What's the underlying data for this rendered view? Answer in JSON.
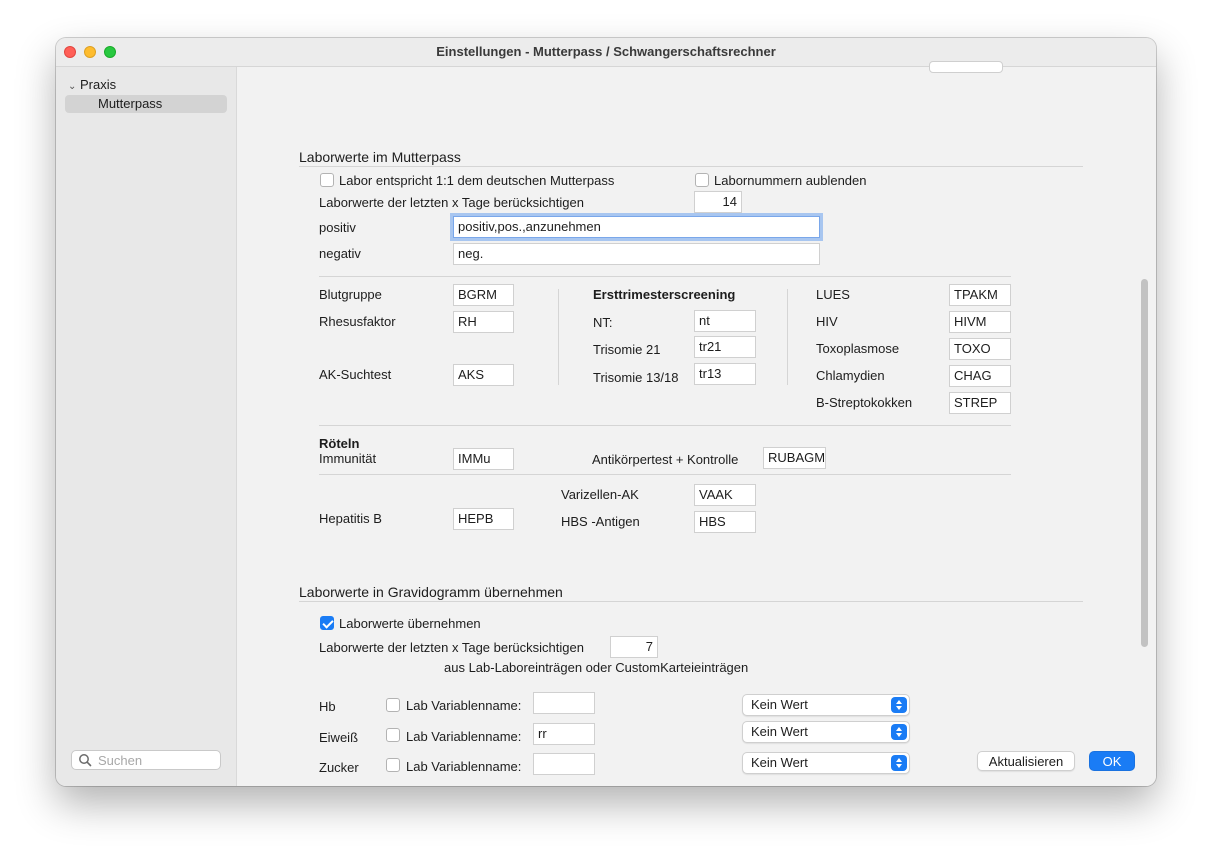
{
  "window": {
    "title": "Einstellungen - Mutterpass / Schwangerschaftsrechner"
  },
  "sidebar": {
    "items": [
      {
        "label": "Praxis"
      },
      {
        "label": "Mutterpass"
      }
    ],
    "search": {
      "placeholder": "Suchen"
    }
  },
  "labor": {
    "title": "Laborwerte im Mutterpass",
    "cb_deutsch_label": "Labor entspricht 1:1 dem deutschen Mutterpass",
    "cb_deutsch_checked": false,
    "cb_labornummern_label": "Labornummern aublenden",
    "cb_labornummern_checked": false,
    "tage_label": "Laborwerte der letzten x Tage berücksichtigen",
    "tage_value": "14",
    "positiv_label": "positiv",
    "positiv_value": "positiv,pos.,anzunehmen",
    "negativ_label": "negativ",
    "negativ_value": "neg.",
    "blutgruppe_label": "Blutgruppe",
    "blutgruppe_value": "BGRM",
    "rhesus_label": "Rhesusfaktor",
    "rhesus_value": "RH",
    "aks_label": "AK-Suchtest",
    "aks_value": "AKS",
    "ersttrimester_title": "Ersttrimesterscreening",
    "nt_label": "NT:",
    "nt_value": "nt",
    "tr21_label": "Trisomie 21",
    "tr21_value": "tr21",
    "tr13_label": "Trisomie 13/18",
    "tr13_value": "tr13",
    "lues_label": "LUES",
    "lues_value": "TPAKM",
    "hiv_label": "HIV",
    "hiv_value": "HIVM",
    "toxo_label": "Toxoplasmose",
    "toxo_value": "TOXO",
    "chlam_label": "Chlamydien",
    "chlam_value": "CHAG",
    "strep_label": "B-Streptokokken",
    "strep_value": "STREP",
    "roeteln_title": "Röteln",
    "immunitaet_label": "Immunität",
    "immunitaet_value": "IMMu",
    "antikoerper_label": "Antikörpertest + Kontrolle",
    "antikoerper_value": "RUBAGM",
    "varizellen_label": "Varizellen-AK",
    "varizellen_value": "VAAK",
    "hepb_label": "Hepatitis B",
    "hepb_value": "HEPB",
    "hbs_label": "HBS -Antigen",
    "hbs_value": "HBS"
  },
  "gravido": {
    "title": "Laborwerte in Gravidogramm übernehmen",
    "cb_uebernehmen_label": "Laborwerte übernehmen",
    "cb_uebernehmen_checked": true,
    "tage_label": "Laborwerte der letzten x Tage berücksichtigen",
    "tage_value": "7",
    "hint": "aus Lab-Laboreinträgen oder CustomKarteieinträgen",
    "rows": [
      {
        "name": "Hb",
        "cb_label": "Lab Variablenname:",
        "var_value": "",
        "select_value": "Kein Wert"
      },
      {
        "name": "Eiweiß",
        "cb_label": "Lab Variablenname:",
        "var_value": "rr",
        "select_value": "Kein Wert"
      },
      {
        "name": "Zucker",
        "cb_label": "Lab Variablenname:",
        "var_value": "",
        "select_value": "Kein Wert"
      }
    ]
  },
  "buttons": {
    "update": "Aktualisieren",
    "ok": "OK"
  }
}
